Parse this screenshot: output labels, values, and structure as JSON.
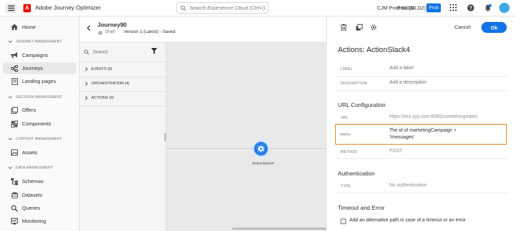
{
  "topbar": {
    "app_title": "Adobe Journey Optimizer",
    "search_placeholder": "Search Experience Cloud (Ctrl+/)",
    "org": "CJM Prod NLD2",
    "sandbox": "Prod (NLD2)",
    "env_badge": "Prod",
    "logo_letter": "A"
  },
  "nav": {
    "home": "Home",
    "sections": {
      "journey_management": "JOURNEY MANAGEMENT",
      "decision_management": "DECISION MANAGEMENT",
      "content_management": "CONTENT MANAGEMENT",
      "data_management": "DATA MANAGEMENT"
    },
    "items": {
      "campaigns": "Campaigns",
      "journeys": "Journeys",
      "landing_pages": "Landing pages",
      "offers": "Offers",
      "components": "Components",
      "assets": "Assets",
      "schemas": "Schemas",
      "datasets": "Datasets",
      "queries": "Queries",
      "monitoring": "Monitoring"
    }
  },
  "journey": {
    "name": "Journey90",
    "status": "Draft",
    "version": "Version 1 (Latest) - Saved"
  },
  "palette": {
    "search_placeholder": "Search",
    "categories": {
      "events": "EVENTS (9)",
      "orchestration": "ORCHESTRATION (4)",
      "actions": "ACTIONS (9)"
    }
  },
  "canvas": {
    "node_label": "ActionSlack4"
  },
  "panel": {
    "cancel": "Cancel",
    "ok": "Ok",
    "title": "Actions: ActionSlack4",
    "label_label": "LABEL",
    "label_placeholder": "Add a label",
    "description_label": "DESCRIPTION",
    "description_placeholder": "Add a description",
    "url_config_title": "URL Configuration",
    "url_label": "URL",
    "url_value": "https://xxx.yyy.com:8080/somethingstatic/",
    "path_label": "PATH",
    "path_line1": "The id of marketingCampaign +",
    "path_line2": "'/messages'",
    "method_label": "METHOD",
    "method_value": "POST",
    "auth_title": "Authentication",
    "type_label": "TYPE",
    "type_value": "No authentication",
    "timeout_title": "Timeout and Error",
    "timeout_checkbox": "Add an alternative path in case of a timeout or an error"
  },
  "colors": {
    "accent": "#1473e6",
    "brand_red": "#eb1000",
    "highlight": "#e8821e"
  }
}
